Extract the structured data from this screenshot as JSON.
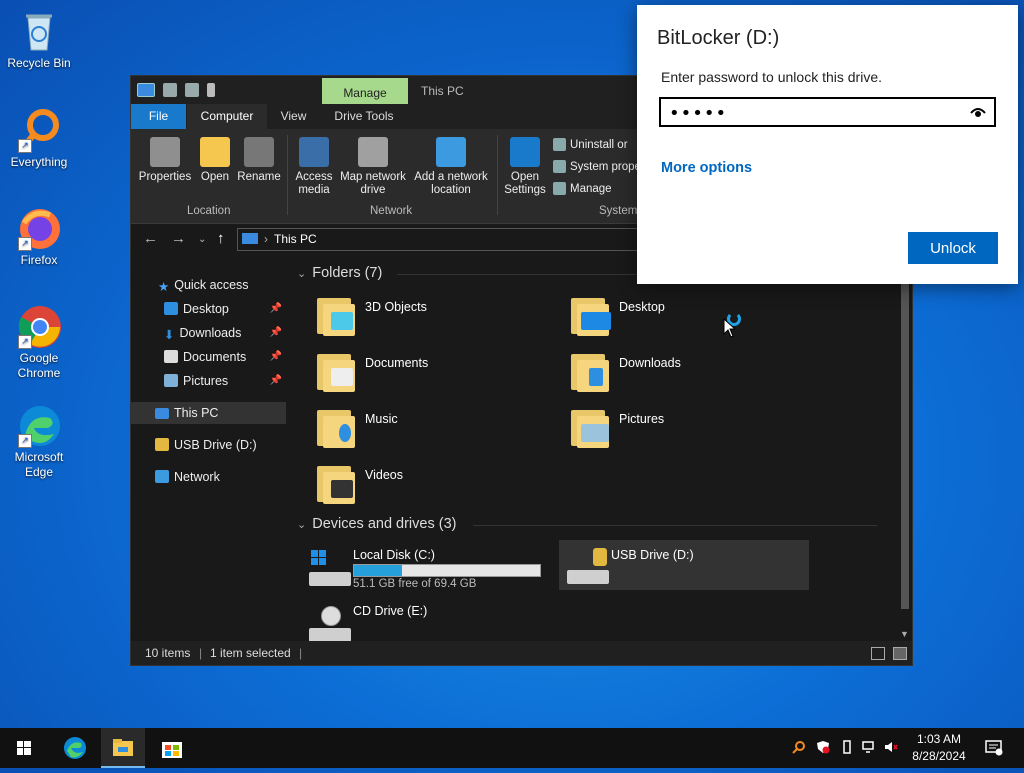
{
  "desktop": {
    "icons": [
      {
        "label": "Recycle Bin",
        "icon": "recycle-bin-icon"
      },
      {
        "label": "Everything",
        "icon": "everything-search-icon"
      },
      {
        "label": "Firefox",
        "icon": "firefox-icon"
      },
      {
        "label": "Google Chrome",
        "icon": "chrome-icon"
      },
      {
        "label": "Microsoft Edge",
        "icon": "edge-icon"
      }
    ]
  },
  "explorer": {
    "context_tab": "Manage",
    "title": "This PC",
    "tabs": [
      "File",
      "Computer",
      "View",
      "Drive Tools"
    ],
    "ribbon": {
      "location": {
        "label": "Location",
        "buttons": [
          "Properties",
          "Open",
          "Rename"
        ]
      },
      "network": {
        "label": "Network",
        "buttons": [
          "Access media",
          "Map network drive",
          "Add a network location"
        ]
      },
      "system": {
        "label": "System",
        "open_settings": "Open Settings",
        "small": [
          "Uninstall or",
          "System prope",
          "Manage"
        ]
      }
    },
    "address": "This PC",
    "nav": {
      "quick_access": "Quick access",
      "pinned": [
        "Desktop",
        "Downloads",
        "Documents",
        "Pictures"
      ],
      "this_pc": "This PC",
      "usb": "USB Drive (D:)",
      "network": "Network"
    },
    "folders_header": "Folders (7)",
    "folders": [
      "3D Objects",
      "Desktop",
      "Documents",
      "Downloads",
      "Music",
      "Pictures",
      "Videos"
    ],
    "drives_header": "Devices and drives (3)",
    "drives": {
      "c": {
        "name": "Local Disk (C:)",
        "free": "51.1 GB free of 69.4 GB",
        "used_fraction": 0.26
      },
      "d": {
        "name": "USB Drive (D:)"
      },
      "e": {
        "name": "CD Drive (E:)"
      }
    },
    "status": {
      "items": "10 items",
      "selected": "1 item selected"
    }
  },
  "bitlocker": {
    "title": "BitLocker (D:)",
    "prompt": "Enter password to unlock this drive.",
    "password_value": "•••••",
    "more_options": "More options",
    "unlock": "Unlock"
  },
  "taskbar": {
    "time": "1:03 AM",
    "date": "8/28/2024"
  }
}
